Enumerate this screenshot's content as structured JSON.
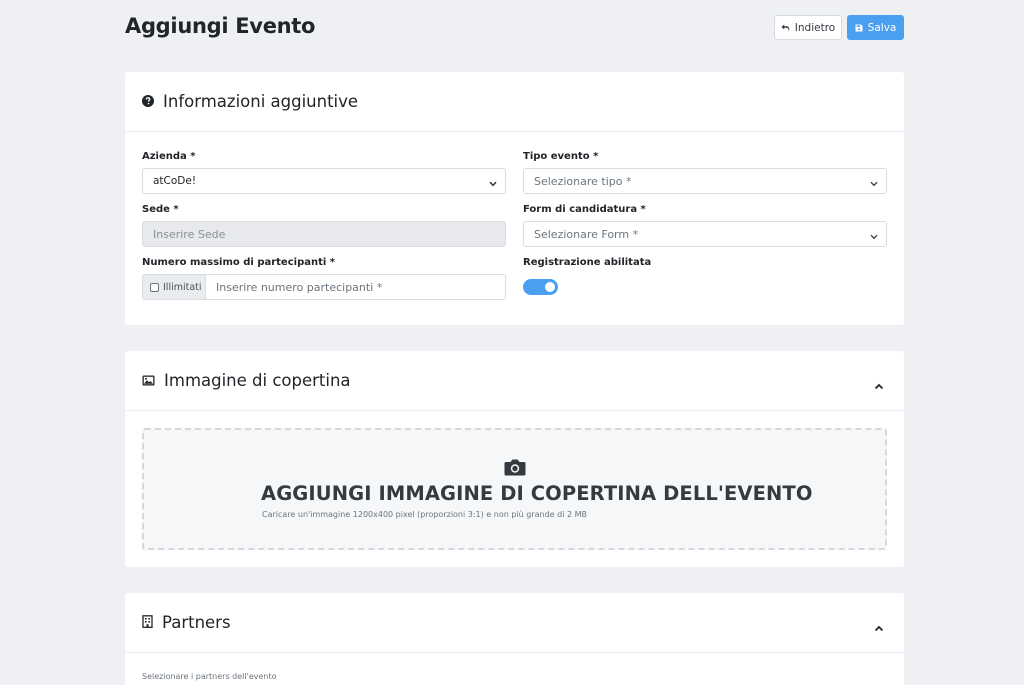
{
  "header": {
    "title": "Aggiungi Evento",
    "back_label": "Indietro",
    "save_label": "Salva"
  },
  "info_section": {
    "title": "Informazioni aggiuntive",
    "azienda": {
      "label": "Azienda *",
      "value": "atCoDe!"
    },
    "tipo_evento": {
      "label": "Tipo evento *",
      "value": "Selezionare tipo *"
    },
    "sede": {
      "label": "Sede *",
      "placeholder": "Inserire Sede"
    },
    "form_candidatura": {
      "label": "Form di candidatura *",
      "value": "Selezionare Form *"
    },
    "max_partecipanti": {
      "label": "Numero massimo di partecipanti *",
      "unlimited_label": "Illimitati",
      "unlimited_checked": false,
      "placeholder": "Inserire numero partecipanti *"
    },
    "registrazione": {
      "label": "Registrazione abilitata",
      "enabled": true
    }
  },
  "cover_section": {
    "title": "Immagine di copertina",
    "drop_title": "AGGIUNGI IMMAGINE DI COPERTINA DELL'EVENTO",
    "drop_hint": "Caricare un'immagine 1200x400 pixel (proporzioni 3:1) e non più grande di 2 MB"
  },
  "partners_section": {
    "title": "Partners",
    "hint": "Selezionare i partners dell'evento"
  },
  "colors": {
    "accent": "#4a9ff1",
    "background": "#eef0f3"
  }
}
